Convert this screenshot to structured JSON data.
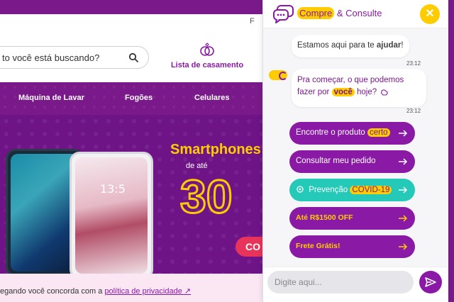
{
  "header": {
    "partial_letter": "F",
    "search_placeholder": "to você está buscando?",
    "wedding_label": "Lista de casamento"
  },
  "nav": {
    "items": [
      "Máquina de Lavar",
      "Fogões",
      "Celulares"
    ]
  },
  "banner": {
    "title": "Smartphones",
    "subtitle": "de até",
    "percent": "30",
    "cta": "CO",
    "phone_time": "13:5"
  },
  "cookie": {
    "text": "egando você concorda com a ",
    "link": "política de privacidade ↗"
  },
  "chat": {
    "title_highlight": "Compre",
    "title_rest": " & Consulte",
    "close_label": "✕",
    "messages": [
      {
        "pre": "Estamos ",
        "hl": "aqui",
        "mid": " para te ",
        "hl2": "ajudar",
        "post": "!",
        "time": "23:12"
      },
      {
        "line1": "Pra começar, o que podemos",
        "line2_pre": "fazer por ",
        "hl": "você",
        "line2_post": " hoje?",
        "time": "23:12"
      }
    ],
    "options": [
      {
        "pre": "Encontre o produto ",
        "hl": "certo"
      },
      {
        "pre": "Consultar meu pedido",
        "hl": ""
      },
      {
        "pre": "Prevenção ",
        "hl": "COVID-19"
      },
      {
        "pre": "Até R$1500 OFF",
        "hl": ""
      },
      {
        "pre": "Frete Grátis!",
        "hl": ""
      }
    ],
    "input_placeholder": "Digite aqui..."
  },
  "colors": {
    "brand_purple": "#8a1aa6",
    "brand_yellow": "#ffcc00",
    "teal": "#25c9b8"
  }
}
